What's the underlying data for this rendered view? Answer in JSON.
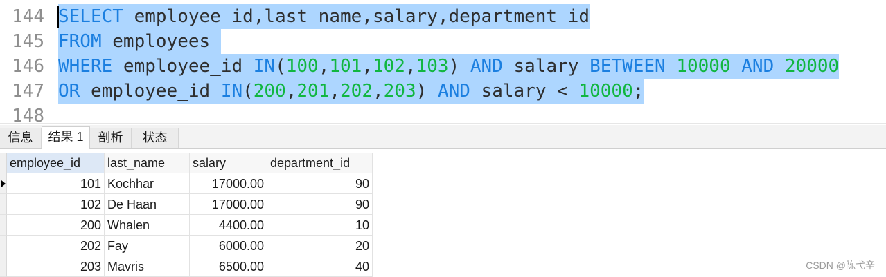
{
  "editor": {
    "lines": [
      {
        "num": "144",
        "tokens": [
          {
            "t": "SELECT",
            "c": "kw"
          },
          {
            "t": " employee_id,last_name,salary,department_id",
            "c": "plain"
          }
        ]
      },
      {
        "num": "145",
        "tokens": [
          {
            "t": "FROM",
            "c": "kw"
          },
          {
            "t": " employees ",
            "c": "plain"
          }
        ]
      },
      {
        "num": "146",
        "tokens": [
          {
            "t": "WHERE",
            "c": "kw"
          },
          {
            "t": " employee_id ",
            "c": "plain"
          },
          {
            "t": "IN",
            "c": "kw"
          },
          {
            "t": "(",
            "c": "plain"
          },
          {
            "t": "100",
            "c": "num"
          },
          {
            "t": ",",
            "c": "plain"
          },
          {
            "t": "101",
            "c": "num"
          },
          {
            "t": ",",
            "c": "plain"
          },
          {
            "t": "102",
            "c": "num"
          },
          {
            "t": ",",
            "c": "plain"
          },
          {
            "t": "103",
            "c": "num"
          },
          {
            "t": ") ",
            "c": "plain"
          },
          {
            "t": "AND",
            "c": "kw"
          },
          {
            "t": " salary ",
            "c": "plain"
          },
          {
            "t": "BETWEEN",
            "c": "kw"
          },
          {
            "t": " ",
            "c": "plain"
          },
          {
            "t": "10000",
            "c": "num"
          },
          {
            "t": " ",
            "c": "plain"
          },
          {
            "t": "AND",
            "c": "kw"
          },
          {
            "t": " ",
            "c": "plain"
          },
          {
            "t": "20000",
            "c": "num"
          }
        ]
      },
      {
        "num": "147",
        "tokens": [
          {
            "t": "OR",
            "c": "kw"
          },
          {
            "t": " employee_id ",
            "c": "plain"
          },
          {
            "t": "IN",
            "c": "kw"
          },
          {
            "t": "(",
            "c": "plain"
          },
          {
            "t": "200",
            "c": "num"
          },
          {
            "t": ",",
            "c": "plain"
          },
          {
            "t": "201",
            "c": "num"
          },
          {
            "t": ",",
            "c": "plain"
          },
          {
            "t": "202",
            "c": "num"
          },
          {
            "t": ",",
            "c": "plain"
          },
          {
            "t": "203",
            "c": "num"
          },
          {
            "t": ") ",
            "c": "plain"
          },
          {
            "t": "AND",
            "c": "kw"
          },
          {
            "t": " salary < ",
            "c": "plain"
          },
          {
            "t": "10000",
            "c": "num"
          },
          {
            "t": ";",
            "c": "plain"
          }
        ]
      },
      {
        "num": "148",
        "tokens": []
      }
    ]
  },
  "tabs": [
    {
      "label": "信息",
      "active": false
    },
    {
      "label": "结果 1",
      "active": true
    },
    {
      "label": "剖析",
      "active": false
    },
    {
      "label": "状态",
      "active": false
    }
  ],
  "grid": {
    "columns": [
      "employee_id",
      "last_name",
      "salary",
      "department_id"
    ],
    "rows": [
      [
        "101",
        "Kochhar",
        "17000.00",
        "90"
      ],
      [
        "102",
        "De Haan",
        "17000.00",
        "90"
      ],
      [
        "200",
        "Whalen",
        "4400.00",
        "10"
      ],
      [
        "202",
        "Fay",
        "6000.00",
        "20"
      ],
      [
        "203",
        "Mavris",
        "6500.00",
        "40"
      ]
    ]
  },
  "watermark": "CSDN @陈弋辛",
  "colors": {
    "keyword": "#1b7fe0",
    "number": "#11b640",
    "selection": "#add6ff"
  }
}
